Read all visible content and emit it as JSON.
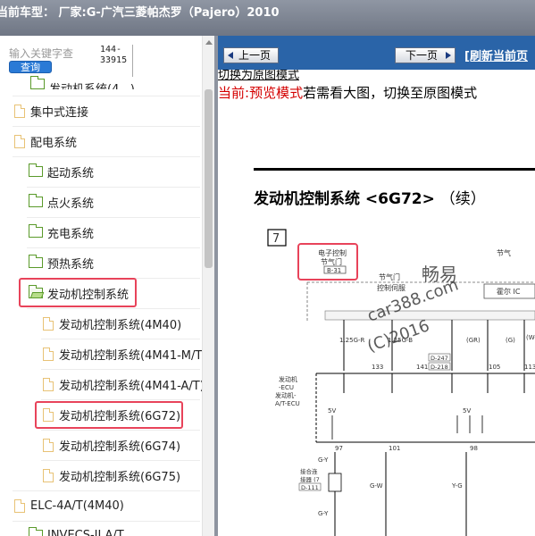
{
  "title_bar": {
    "text": "当前车型：  厂家:G-广汽三菱帕杰罗（Pajero）2010"
  },
  "search": {
    "placeholder": "输入关键字查",
    "button_label": "查询"
  },
  "code_box": {
    "line1": "144-",
    "line2": "33915"
  },
  "tree": {
    "partial_top": "发动机系统(4...)",
    "items": [
      {
        "label": "集中式连接",
        "icon": "doc-icon"
      },
      {
        "label": "配电系统",
        "icon": "doc-icon"
      },
      {
        "label": "起动系统",
        "icon": "folder-icon"
      },
      {
        "label": "点火系统",
        "icon": "folder-icon"
      },
      {
        "label": "充电系统",
        "icon": "folder-icon"
      },
      {
        "label": "预热系统",
        "icon": "folder-icon"
      },
      {
        "label": "发动机控制系统",
        "icon": "folder-open-icon",
        "highlighted": true
      },
      {
        "label": "发动机控制系统(4M40)",
        "icon": "doc-icon"
      },
      {
        "label": "发动机控制系统(4M41-M/T",
        "icon": "doc-icon"
      },
      {
        "label": "发动机控制系统(4M41-A/T)",
        "icon": "doc-icon"
      },
      {
        "label": "发动机控制系统(6G72)",
        "icon": "doc-icon",
        "highlighted": true
      },
      {
        "label": "发动机控制系统(6G74)",
        "icon": "doc-icon"
      },
      {
        "label": "发动机控制系统(6G75)",
        "icon": "doc-icon"
      },
      {
        "label": "ELC-4A/T(4M40)",
        "icon": "doc-icon"
      },
      {
        "label": "INVECS-II A/T",
        "icon": "folder-icon"
      }
    ]
  },
  "nav": {
    "prev_label": "上一页",
    "next_label": "下一页",
    "refresh_label": "[刷新当前页"
  },
  "view": {
    "switch_link": "切换为原图模式",
    "mode_prefix": "当前:",
    "mode_current": "预览模式",
    "mode_hint": "若需看大图，切换至原图模式"
  },
  "diagram": {
    "title": "发动机控制系统 <6G72>",
    "title_suffix": "（续）",
    "section_number": "7",
    "throttle_label_1": "电子控制",
    "throttle_label_2": "节气门",
    "throttle_code": "B-31",
    "valve_label_1": "节气门",
    "valve_label_2": "控制伺服",
    "right_label": "节气",
    "hall_label": "霍尔 IC",
    "wire_1": "1.25G-R",
    "wire_2": "1.25G-B",
    "wire_3": "(GR)",
    "wire_4": "(G)",
    "wire_5": "(W-",
    "pin_133": "133",
    "pin_141": "141",
    "pin_105": "105",
    "pin_113": "113",
    "conn_1": "D-247",
    "conn_2": "D-218",
    "ecu_label_1": "发动机",
    "ecu_label_2": "-ECU",
    "ecu_label_3": "发动机-",
    "ecu_label_4": "A/T-ECU",
    "volt_1": "5V",
    "volt_2": "5V",
    "pin_97": "97",
    "pin_101": "101",
    "pin_98": "98",
    "gy_1": "G-Y",
    "gy_2": "G-Y",
    "gw": "G-W",
    "yg": "Y-G",
    "joint_1": "接合连",
    "joint_2": "接器 (7",
    "joint_code": "D-111",
    "watermark_1": "畅易",
    "watermark_2": "car388.com",
    "watermark_3": "(C)2016"
  }
}
